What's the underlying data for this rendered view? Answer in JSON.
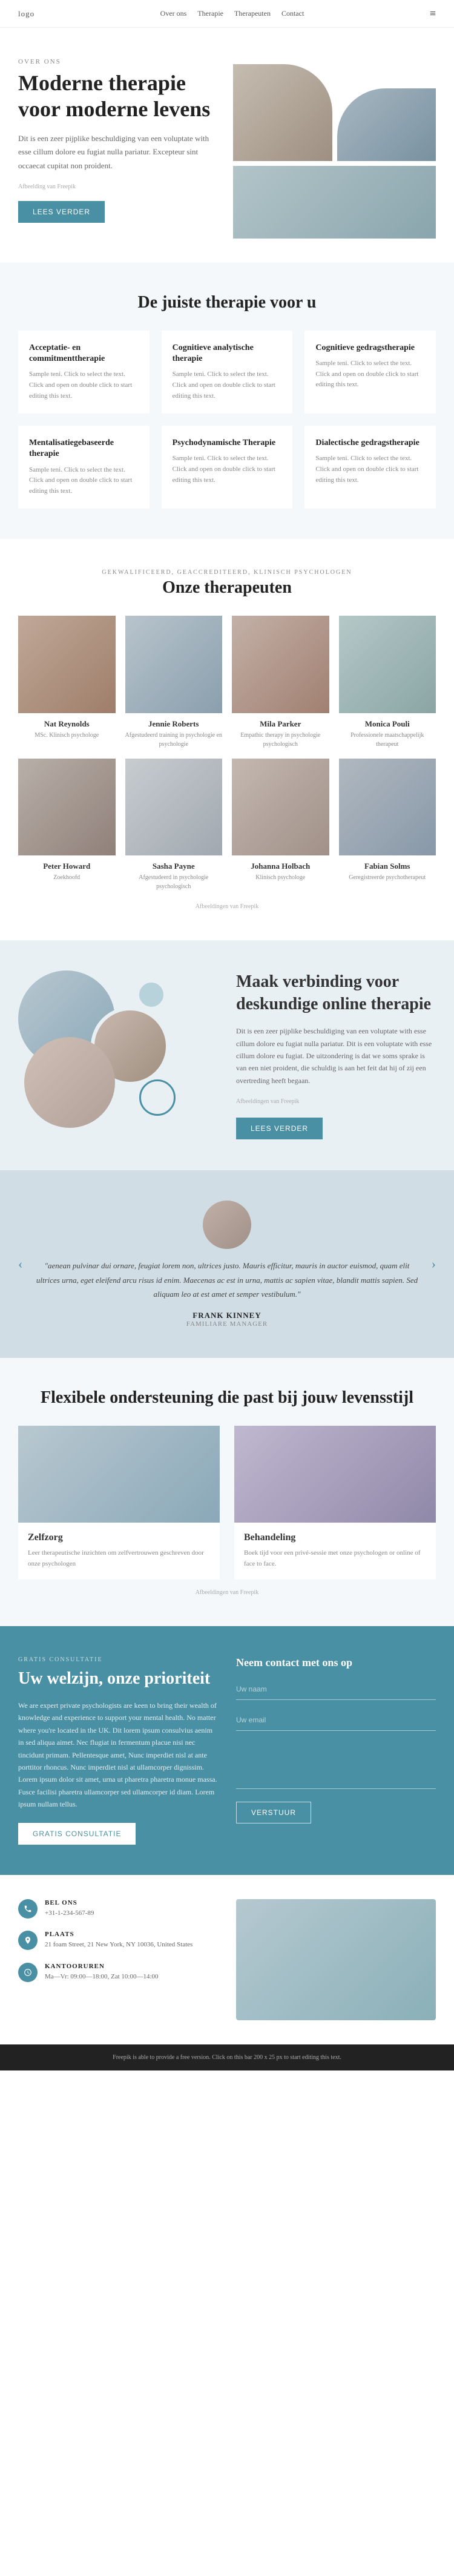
{
  "navbar": {
    "logo": "logo",
    "menu_icon": "≡"
  },
  "hero": {
    "over_ons": "OVER ONS",
    "title": "Moderne therapie voor moderne levens",
    "text": "Dit is een zeer pijplike beschuldiging van een voluptate with esse cillum dolore eu fugiat nulla pariatur. Excepteur sint occaecat cupitat non proident.",
    "img_credit": "Afbeelding van Freepik",
    "btn_label": "LEES VERDER"
  },
  "services": {
    "section_title": "De juiste therapie voor u",
    "cards": [
      {
        "title": "Acceptatie- en commitmenttherapie",
        "text": "Sample teni. Click to select the text. Click and open on double click to start editing this text."
      },
      {
        "title": "Cognitieve analytische therapie",
        "text": "Sample teni. Click to select the text. Click and open on double click to start editing this text."
      },
      {
        "title": "Cognitieve gedragstherapie",
        "text": "Sample teni. Click to select the text. Click and open on double click to start editing this text."
      },
      {
        "title": "Mentalisatiegebaseerde therapie",
        "text": "Sample teni. Click to select the text. Click and open on double click to start editing this text."
      },
      {
        "title": "Psychodynamische Therapie",
        "text": "Sample teni. Click to select the text. Click and open on double click to start editing this text."
      },
      {
        "title": "Dialectische gedragstherapie",
        "text": "Sample teni. Click to select the text. Click and open on double click to start editing this text."
      }
    ]
  },
  "therapists": {
    "subtitle": "GEKWALIFICEERD, GEACCREDITEERD, KLINISCH PSYCHOLOGEN",
    "section_title": "Onze therapeuten",
    "img_credit": "Afbeeldingen van Freepik",
    "people": [
      {
        "name": "Nat Reynolds",
        "role": "MSc. Klinisch psychologe"
      },
      {
        "name": "Jennie Roberts",
        "role": "Afgestudeerd training in psychologie en psychologie"
      },
      {
        "name": "Mila Parker",
        "role": "Empathic therapy in psychologie psychologisch"
      },
      {
        "name": "Monica Pouli",
        "role": "Professionele maatschappelijk therapeut"
      },
      {
        "name": "Peter Howard",
        "role": "Zoekhoofd"
      },
      {
        "name": "Sasha Payne",
        "role": "Afgestudeerd in psychologie psychologisch"
      },
      {
        "name": "Johanna Holbach",
        "role": "Klinisch psychologe"
      },
      {
        "name": "Fabian Solms",
        "role": "Geregistreerde psychotherapeut"
      }
    ]
  },
  "online_therapy": {
    "img_credit": "Afbeeldingen van Freepik",
    "title": "Maak verbinding voor deskundige online therapie",
    "text": "Dit is een zeer pijplike beschuldiging van een voluptate with esse cillum dolore eu fugiat nulla pariatur. Dit is een voluptate with esse cillum dolore eu fugiat. De uitzondering is dat we soms sprake is van een niet proident, die schuldig is aan het feit dat hij of zij een overtreding heeft begaan.",
    "btn_label": "LEES VERDER"
  },
  "testimonial": {
    "quote": "\"aenean pulvinar dui ornare, feugiat lorem non, ultrices justo. Mauris efficitur, mauris in auctor euismod, quam elit ultrices urna, eget eleifend arcu risus id enim. Maecenas ac est in urna, mattis ac sapien vitae, blandit mattis sapien. Sed aliquam leo at est amet et semper vestibulum.\"",
    "name": "FRANK KINNEY",
    "role": "FAMILIARE MANAGER",
    "prev_arrow": "‹",
    "next_arrow": "›"
  },
  "support": {
    "section_title": "Flexibele ondersteuning die past bij jouw levensstijl",
    "img_credit": "Afbeeldingen van Freepik",
    "cards": [
      {
        "title": "Zelfzorg",
        "text": "Leer therapeutische inzichten om zelfvertrouwen geschreven door onze psychologen"
      },
      {
        "title": "Behandeling",
        "text": "Boek tijd voor een privé-sessie met onze psychologen or online of face to face."
      }
    ]
  },
  "consultation": {
    "tag": "GRATIS CONSULTATIE",
    "title": "Uw welzijn, onze prioriteit",
    "text": "We are expert private psychologists are keen to bring their wealth of knowledge and experience to support your mental health. No matter where you're located in the UK. Dit lorem ipsum consulvius aenim in sed aliqua aimet. Nec flugiat in fermentum placue nisi nec tincidunt primam. Pellentesque amet, Nunc imperdiet nisl at ante porttitor rhoncus. Nunc imperdiet nisl at ullamcorper dignissim. Lorem ipsum dolor sit amet, urna ut pharetra pharetra monue massa. Fusce facilisi pharetra ullamcorper sed ullamcorper id diam. Lorem ipsum nullam tellus.",
    "btn_label": "GRATIS CONSULTATIE",
    "form_title": "Neem contact met ons op",
    "form_fields": {
      "name_placeholder": "Uw naam",
      "email_placeholder": "Uw email",
      "message_placeholder": ""
    },
    "submit_label": "VERSTUUR"
  },
  "contact": {
    "items": [
      {
        "icon": "📞",
        "label": "BEL ONS",
        "value": "+31-1-234-567-89"
      },
      {
        "icon": "📍",
        "label": "PLAATS",
        "value": "21 foam Street, 21 New York, NY 10036, United States"
      },
      {
        "icon": "🕐",
        "label": "KANTOORUREN",
        "value": "Ma—Vr: 09:00—18:00, Zat 10:00—14:00"
      }
    ]
  },
  "footer": {
    "text": "Freepik is able to provide a free version. Click on this bar 200 x 25 px to start editing this text."
  }
}
